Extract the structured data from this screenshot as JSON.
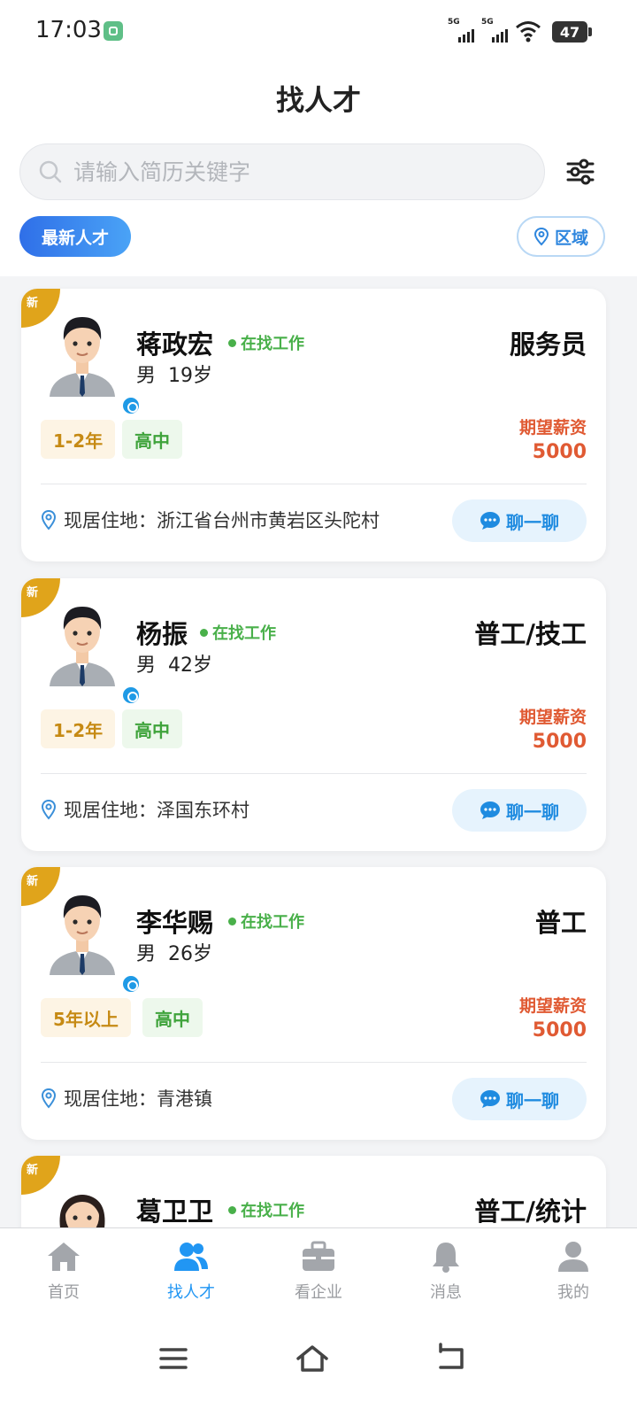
{
  "status_bar": {
    "time": "17:03",
    "signal_1": "5G",
    "signal_2": "5G",
    "battery": "47"
  },
  "header": {
    "title": "找人才"
  },
  "search": {
    "placeholder": "请输入简历关键字"
  },
  "filters": {
    "latest_label": "最新人才",
    "area_label": "区域"
  },
  "labels": {
    "new_badge": "新",
    "salary_label": "期望薪资",
    "residence_prefix": "现居住地：",
    "chat_label": "聊一聊"
  },
  "candidates": [
    {
      "name": "蒋政宏",
      "status": "在找工作",
      "gender": "男",
      "age": "19岁",
      "job": "服务员",
      "experience": "1-2年",
      "education": "高中",
      "salary": "5000",
      "residence": "浙江省台州市黄岩区头陀村",
      "avatar": "male-avatar"
    },
    {
      "name": "杨振",
      "status": "在找工作",
      "gender": "男",
      "age": "42岁",
      "job": "普工/技工",
      "experience": "1-2年",
      "education": "高中",
      "salary": "5000",
      "residence": "泽国东环村",
      "avatar": "male-avatar"
    },
    {
      "name": "李华赐",
      "status": "在找工作",
      "gender": "男",
      "age": "26岁",
      "job": "普工",
      "experience": "5年以上",
      "education": "高中",
      "salary": "5000",
      "residence": "青港镇",
      "avatar": "male-avatar"
    },
    {
      "name": "葛卫卫",
      "status": "在找工作",
      "job": "普工/统计",
      "avatar": "female-avatar"
    }
  ],
  "tabs": [
    {
      "label": "首页",
      "icon": "home-icon",
      "active": false
    },
    {
      "label": "找人才",
      "icon": "users-icon",
      "active": true
    },
    {
      "label": "看企业",
      "icon": "briefcase-icon",
      "active": false
    },
    {
      "label": "消息",
      "icon": "bell-icon",
      "active": false
    },
    {
      "label": "我的",
      "icon": "person-icon",
      "active": false
    }
  ],
  "colors": {
    "accent": "#2196f3",
    "status_green": "#49b04a",
    "salary_red": "#e05a33",
    "badge_gold": "#e0a41b"
  }
}
